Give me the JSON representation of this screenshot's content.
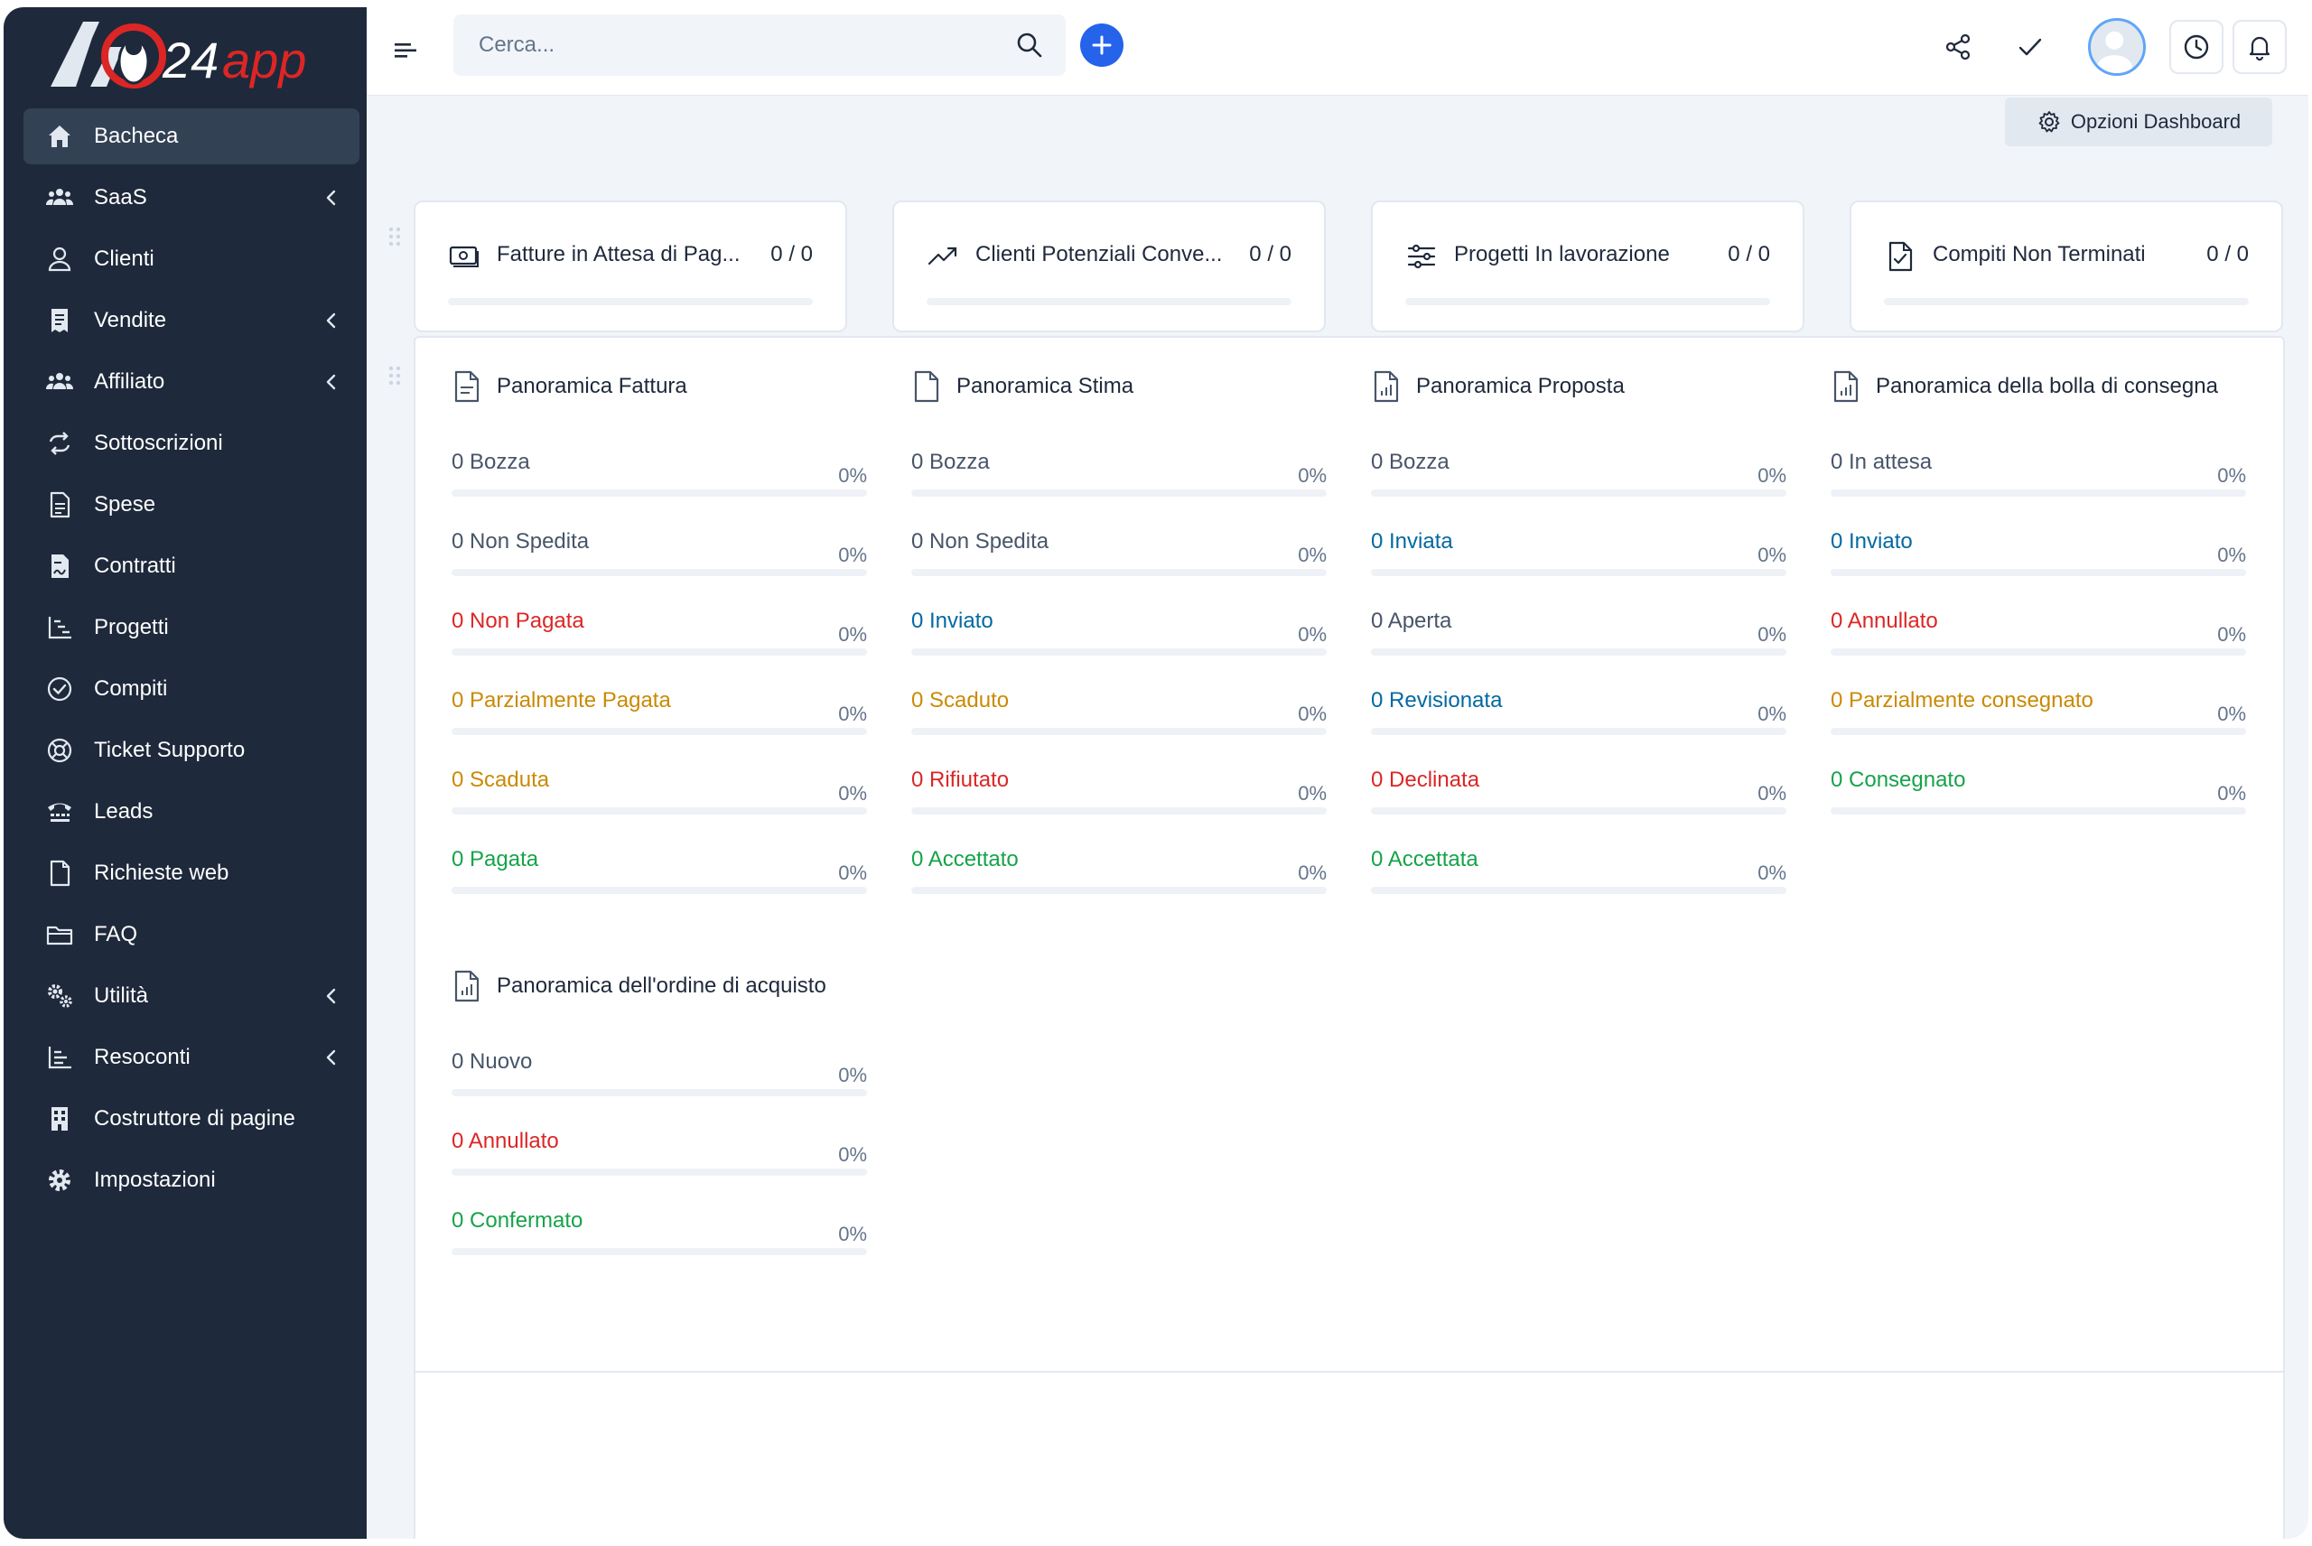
{
  "app": {
    "logo_text": "24app",
    "accent_color": "#2563eb"
  },
  "sidebar": {
    "items": [
      {
        "label": "Bacheca",
        "icon": "home-icon"
      },
      {
        "label": "SaaS",
        "icon": "users-icon"
      },
      {
        "label": "Clienti",
        "icon": "user-icon"
      },
      {
        "label": "Vendite",
        "icon": "receipt-icon"
      },
      {
        "label": "Affiliato",
        "icon": "users-icon"
      },
      {
        "label": "Sottoscrizioni",
        "icon": "repeat-icon"
      },
      {
        "label": "Spese",
        "icon": "file-text-icon"
      },
      {
        "label": "Contratti",
        "icon": "file-signature-icon"
      },
      {
        "label": "Progetti",
        "icon": "chart-steps-icon"
      },
      {
        "label": "Compiti",
        "icon": "check-circle-icon"
      },
      {
        "label": "Ticket Supporto",
        "icon": "life-ring-icon"
      },
      {
        "label": "Leads",
        "icon": "tty-icon"
      },
      {
        "label": "Richieste web",
        "icon": "file-icon"
      },
      {
        "label": "FAQ",
        "icon": "folder-icon"
      },
      {
        "label": "Utilità",
        "icon": "cogs-icon"
      },
      {
        "label": "Resoconti",
        "icon": "bar-chart-icon"
      },
      {
        "label": "Costruttore di pagine",
        "icon": "building-icon"
      },
      {
        "label": "Impostazioni",
        "icon": "gear-icon"
      }
    ]
  },
  "topbar": {
    "search_placeholder": "Cerca..."
  },
  "dashboard": {
    "options_label": "Opzioni Dashboard"
  },
  "stats": [
    {
      "label": "Fatture in Attesa di Pag...",
      "count": "0 / 0",
      "progress": 0
    },
    {
      "label": "Clienti Potenziali Conve...",
      "count": "0 / 0",
      "progress": 0
    },
    {
      "label": "Progetti In lavorazione",
      "count": "0 / 0",
      "progress": 0
    },
    {
      "label": "Compiti Non Terminati",
      "count": "0 / 0",
      "progress": 0
    }
  ],
  "overviews": {
    "fattura": {
      "title": "Panoramica Fattura",
      "rows": [
        {
          "label": "0 Bozza",
          "pct": "0%"
        },
        {
          "label": "0 Non Spedita",
          "pct": "0%"
        },
        {
          "label": "0 Non Pagata",
          "pct": "0%"
        },
        {
          "label": "0 Parzialmente Pagata",
          "pct": "0%"
        },
        {
          "label": "0 Scaduta",
          "pct": "0%"
        },
        {
          "label": "0 Pagata",
          "pct": "0%"
        }
      ]
    },
    "stima": {
      "title": "Panoramica Stima",
      "rows": [
        {
          "label": "0 Bozza",
          "pct": "0%"
        },
        {
          "label": "0 Non Spedita",
          "pct": "0%"
        },
        {
          "label": "0 Inviato",
          "pct": "0%"
        },
        {
          "label": "0 Scaduto",
          "pct": "0%"
        },
        {
          "label": "0 Rifiutato",
          "pct": "0%"
        },
        {
          "label": "0 Accettato",
          "pct": "0%"
        }
      ]
    },
    "proposta": {
      "title": "Panoramica Proposta",
      "rows": [
        {
          "label": "0 Bozza",
          "pct": "0%"
        },
        {
          "label": "0 Inviata",
          "pct": "0%"
        },
        {
          "label": "0 Aperta",
          "pct": "0%"
        },
        {
          "label": "0 Revisionata",
          "pct": "0%"
        },
        {
          "label": "0 Declinata",
          "pct": "0%"
        },
        {
          "label": "0 Accettata",
          "pct": "0%"
        }
      ]
    },
    "bolla": {
      "title": "Panoramica della bolla di consegna",
      "rows": [
        {
          "label": "0 In attesa",
          "pct": "0%"
        },
        {
          "label": "0 Inviato",
          "pct": "0%"
        },
        {
          "label": "0 Annullato",
          "pct": "0%"
        },
        {
          "label": "0 Parzialmente consegnato",
          "pct": "0%"
        },
        {
          "label": "0 Consegnato",
          "pct": "0%"
        }
      ]
    },
    "ordine": {
      "title": "Panoramica dell'ordine di acquisto",
      "rows": [
        {
          "label": "0 Nuovo",
          "pct": "0%"
        },
        {
          "label": "0 Annullato",
          "pct": "0%"
        },
        {
          "label": "0 Confermato",
          "pct": "0%"
        }
      ]
    }
  }
}
